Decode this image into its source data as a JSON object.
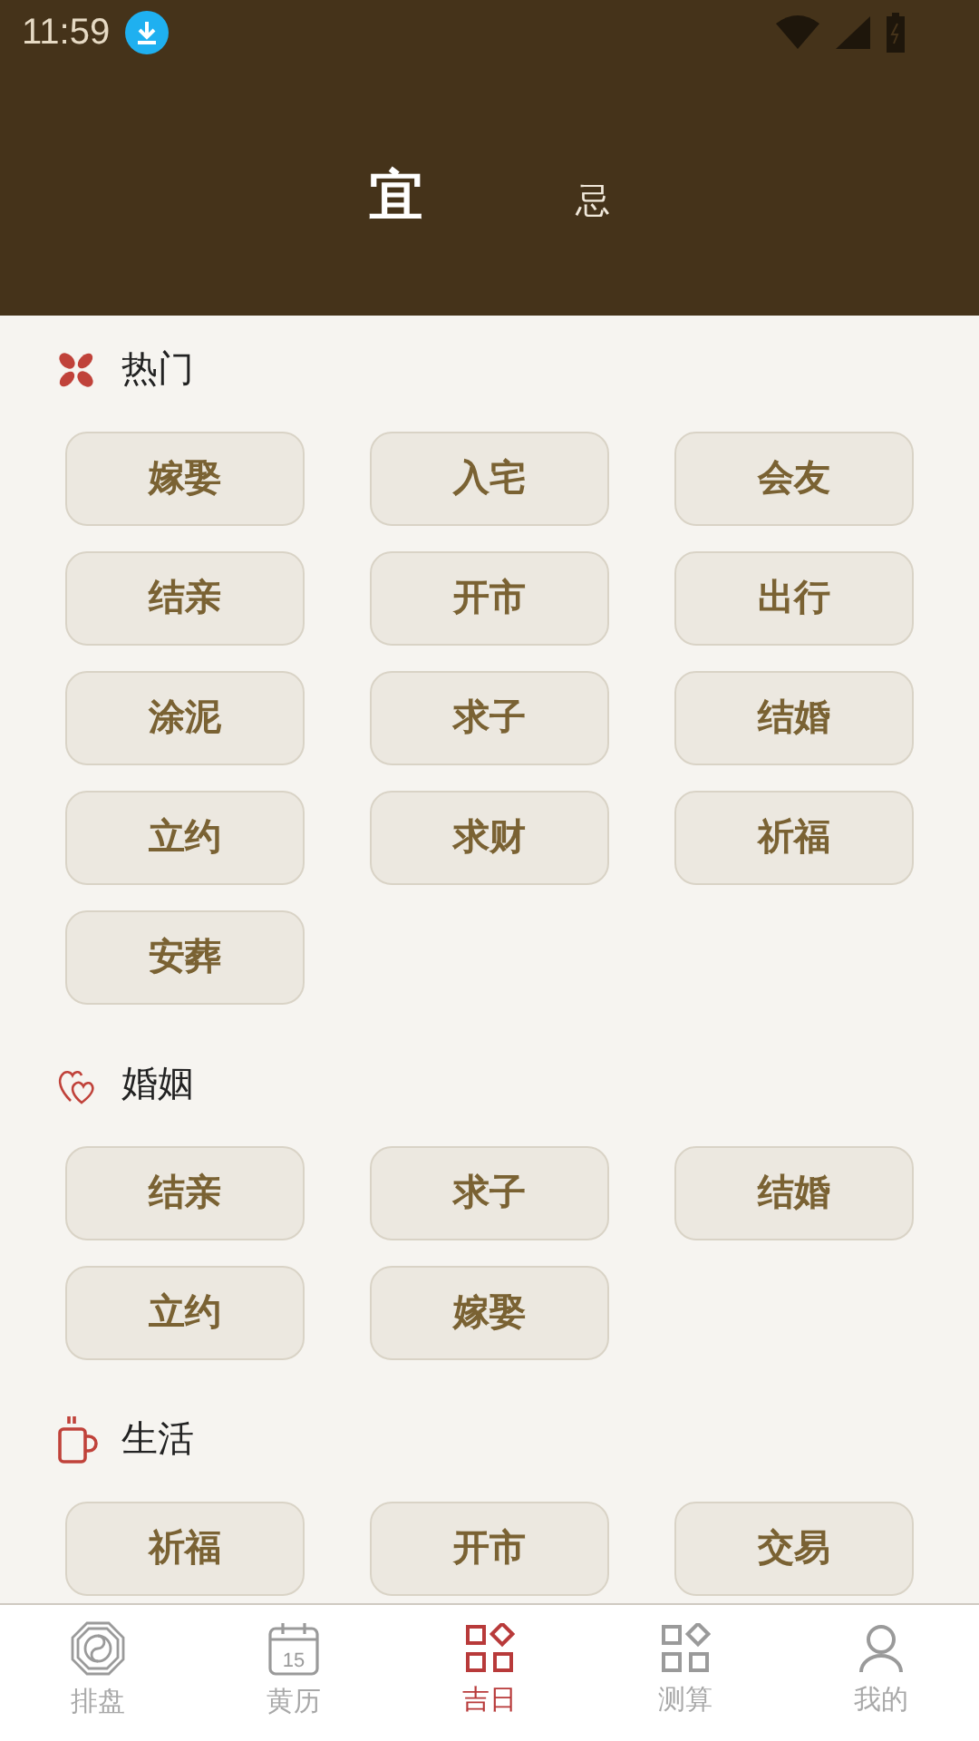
{
  "status_bar": {
    "time": "11:59"
  },
  "tabs": [
    {
      "label": "宜",
      "selected": true
    },
    {
      "label": "忌",
      "selected": false
    }
  ],
  "sections": [
    {
      "kind": "hot",
      "title": "热门",
      "items": [
        "嫁娶",
        "入宅",
        "会友",
        "结亲",
        "开市",
        "出行",
        "涂泥",
        "求子",
        "结婚",
        "立约",
        "求财",
        "祈福",
        "安葬"
      ]
    },
    {
      "kind": "marriage",
      "title": "婚姻",
      "items": [
        "结亲",
        "求子",
        "结婚",
        "立约",
        "嫁娶"
      ]
    },
    {
      "kind": "life",
      "title": "生活",
      "items": [
        "祈福",
        "开市",
        "交易"
      ]
    }
  ],
  "bottom_nav": [
    {
      "kind": "bagua",
      "label": "排盘",
      "selected": false
    },
    {
      "kind": "calendar",
      "label": "黄历",
      "selected": false,
      "icon_text": "15"
    },
    {
      "kind": "grid",
      "label": "吉日",
      "selected": true
    },
    {
      "kind": "grid",
      "label": "测算",
      "selected": false
    },
    {
      "kind": "person",
      "label": "我的",
      "selected": false
    }
  ]
}
